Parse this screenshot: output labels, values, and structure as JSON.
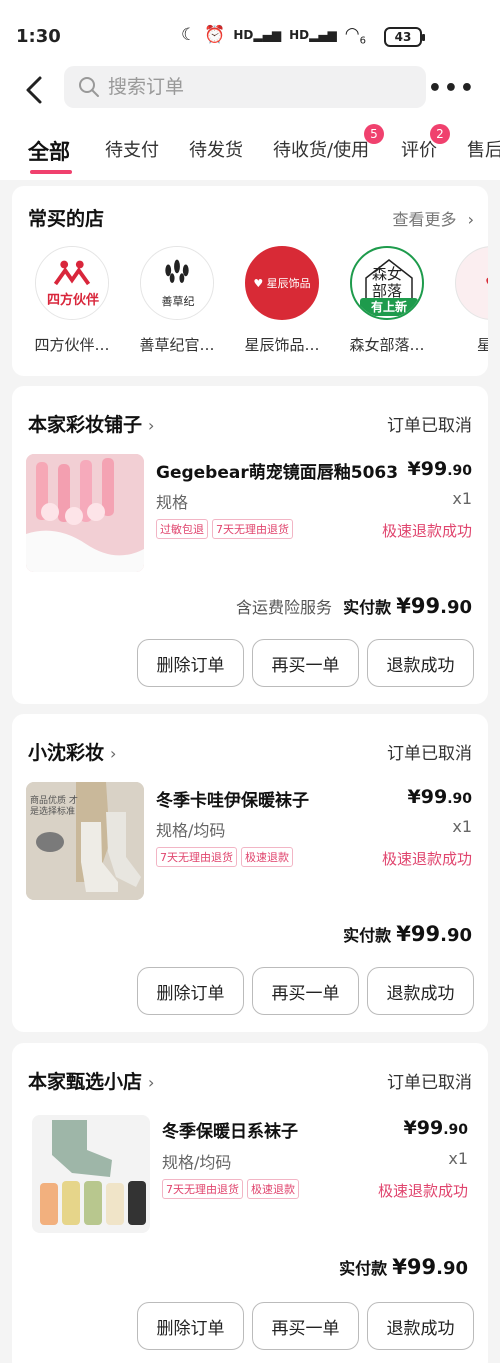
{
  "status_bar": {
    "time": "1:30",
    "signal1": "HD",
    "signal2": "HD",
    "wifi_sub": "6",
    "battery": "43"
  },
  "header": {
    "search_placeholder": "搜索订单"
  },
  "tabs": [
    {
      "label": "全部",
      "active": true
    },
    {
      "label": "待支付"
    },
    {
      "label": "待发货"
    },
    {
      "label": "待收货/使用",
      "badge": "5"
    },
    {
      "label": "评价",
      "badge": "2"
    },
    {
      "label": "售后"
    }
  ],
  "frequent_stores": {
    "title": "常买的店",
    "see_more": "查看更多",
    "stores": [
      {
        "name": "四方伙伴…",
        "logo_text": "四方伙伴"
      },
      {
        "name": "善草纪官…",
        "logo_text": "善草纪"
      },
      {
        "name": "星辰饰品…",
        "logo_text": "星辰饰品"
      },
      {
        "name": "森女部落…",
        "logo_text": "森女部落",
        "tag": "有上新"
      },
      {
        "name": "星辰"
      }
    ]
  },
  "orders": [
    {
      "shop": "本家彩妆铺子",
      "status": "订单已取消",
      "product": "Gegebear萌宠镜面唇釉5063",
      "price_main": "¥99",
      "price_dec": ".90",
      "spec": "规格",
      "qty": "x1",
      "tags": [
        "过敏包退",
        "7天无理由退货"
      ],
      "refund": "极速退款成功",
      "insurance": "含运费险服务",
      "paid_label": "实付款",
      "paid_main": "¥99",
      "paid_dec": ".90",
      "buttons": [
        "删除订单",
        "再买一单",
        "退款成功"
      ]
    },
    {
      "shop": "小沈彩妆",
      "status": "订单已取消",
      "product": "冬季卡哇伊保暖袜子",
      "price_main": "¥99",
      "price_dec": ".90",
      "spec": "规格/均码",
      "qty": "x1",
      "tags": [
        "7天无理由退货",
        "极速退款"
      ],
      "refund": "极速退款成功",
      "paid_label": "实付款",
      "paid_main": "¥99",
      "paid_dec": ".90",
      "buttons": [
        "删除订单",
        "再买一单",
        "退款成功"
      ],
      "thumb_text": "商品优质 才是选择标准"
    },
    {
      "shop": "本家甄选小店",
      "status": "订单已取消",
      "product": "冬季保暖日系袜子",
      "price_main": "¥99",
      "price_dec": ".90",
      "spec": "规格/均码",
      "qty": "x1",
      "tags": [
        "7天无理由退货",
        "极速退款"
      ],
      "refund": "极速退款成功",
      "paid_label": "实付款",
      "paid_main": "¥99",
      "paid_dec": ".90",
      "buttons": [
        "删除订单",
        "再买一单",
        "退款成功"
      ]
    }
  ],
  "colors": {
    "accent": "#f0416e",
    "new_tag": "#1e9b4c"
  }
}
